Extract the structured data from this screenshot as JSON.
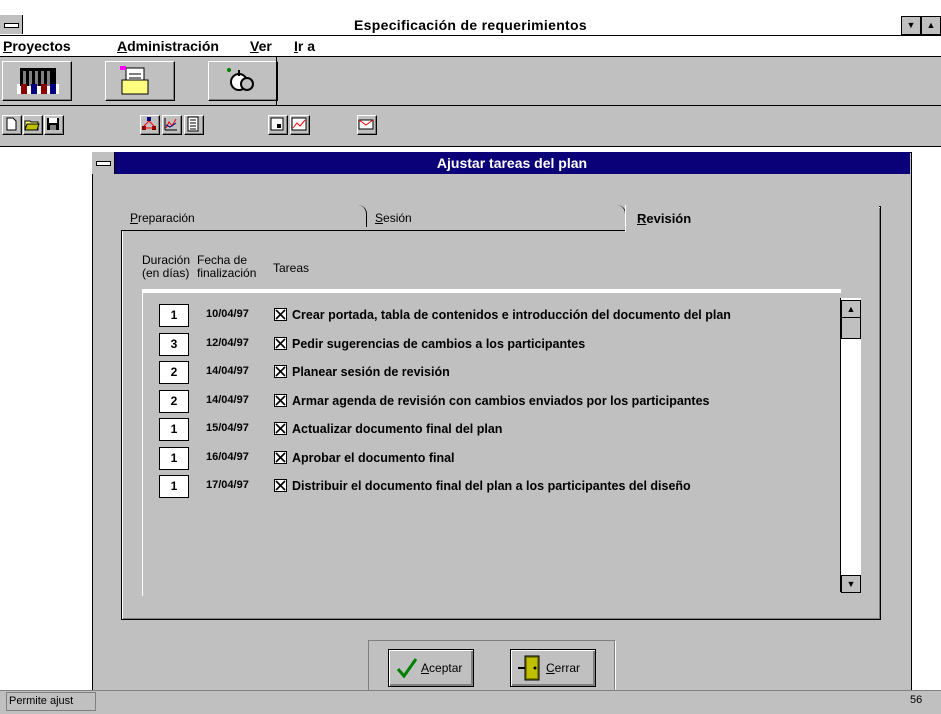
{
  "window": {
    "title": "Especificación de requerimientos",
    "minimize_glyph": "▼",
    "maximize_glyph": "▲"
  },
  "menu": [
    {
      "label": "Proyectos",
      "mnemonic": "P"
    },
    {
      "label": "Administración",
      "mnemonic": "A"
    },
    {
      "label": "Ver",
      "mnemonic": "V"
    },
    {
      "label": "Ir a",
      "mnemonic": "I"
    }
  ],
  "toolbar_big": [
    "people-icon",
    "folder-document-icon",
    "keys-icon"
  ],
  "toolbar_small": [
    "new-document-icon",
    "open-folder-icon",
    "save-icon",
    "network-icon",
    "chart-icon",
    "list-icon",
    "page-icon",
    "graph-icon",
    "envelope-icon"
  ],
  "dialog": {
    "title": "Ajustar tareas del plan",
    "tabs": [
      {
        "label": "Preparación",
        "mnemonic": "P",
        "active": false
      },
      {
        "label": "Sesión",
        "mnemonic": "S",
        "active": false
      },
      {
        "label": "Revisión",
        "mnemonic": "R",
        "active": true
      }
    ],
    "columns": {
      "duration_line1": "Duración",
      "duration_line2": "(en días)",
      "date_line1": "Fecha de",
      "date_line2": "finalización",
      "tasks": "Tareas"
    },
    "tasks": [
      {
        "duration": "1",
        "date": "10/04/97",
        "checked": true,
        "text": "Crear portada, tabla de contenidos e introducción del documento del plan"
      },
      {
        "duration": "3",
        "date": "12/04/97",
        "checked": true,
        "text": "Pedir sugerencias de cambios a los participantes"
      },
      {
        "duration": "2",
        "date": "14/04/97",
        "checked": true,
        "text": "Planear sesión de revisión"
      },
      {
        "duration": "2",
        "date": "14/04/97",
        "checked": true,
        "text": "Armar agenda de revisión  con cambios  enviados por los participantes"
      },
      {
        "duration": "1",
        "date": "15/04/97",
        "checked": true,
        "text": "Actualizar documento final del plan"
      },
      {
        "duration": "1",
        "date": "16/04/97",
        "checked": true,
        "text": "Aprobar el documento final"
      },
      {
        "duration": "1",
        "date": "17/04/97",
        "checked": true,
        "text": "Distribuir  el documento final del plan a  los participantes del diseño"
      }
    ],
    "buttons": {
      "accept": {
        "label": "Aceptar",
        "mnemonic": "A"
      },
      "close": {
        "label": "Cerrar",
        "mnemonic": "C"
      }
    }
  },
  "status": {
    "left_text": "Permite ajust",
    "right_text": "56"
  },
  "colors": {
    "face": "#c0c0c0",
    "dialog_title_bg": "#0a0078",
    "check_green": "#008000"
  }
}
